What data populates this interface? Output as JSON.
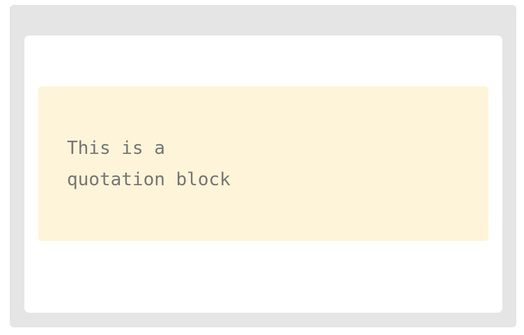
{
  "quote": {
    "text": "This is a\nquotation block"
  },
  "colors": {
    "frame_background": "#e5e5e5",
    "card_background": "#ffffff",
    "quote_background": "#fef4d9",
    "quote_text": "#757575"
  }
}
